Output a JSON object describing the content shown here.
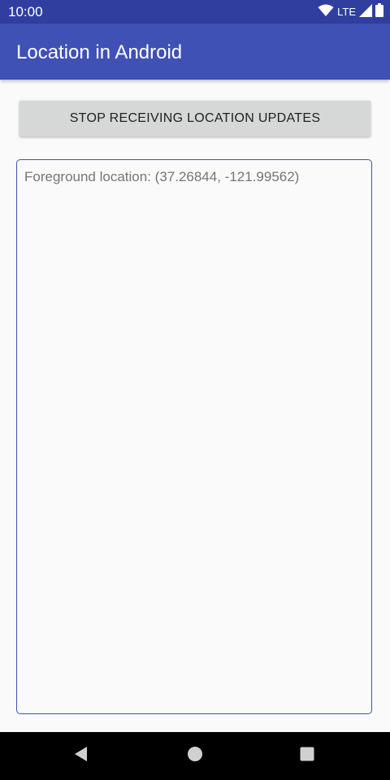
{
  "status_bar": {
    "time": "10:00",
    "network": "LTE",
    "icons": [
      "wifi-icon",
      "cell-signal-icon",
      "battery-icon"
    ],
    "color": "#303f9f"
  },
  "app_bar": {
    "title": "Location in Android",
    "color": "#3f51b5"
  },
  "main": {
    "stop_button_label": "STOP RECEIVING LOCATION UPDATES",
    "output_text": "Foreground location: (37.26844, -121.99562)"
  },
  "nav_bar": {
    "icons": [
      "back-icon",
      "home-icon",
      "recents-icon"
    ]
  }
}
